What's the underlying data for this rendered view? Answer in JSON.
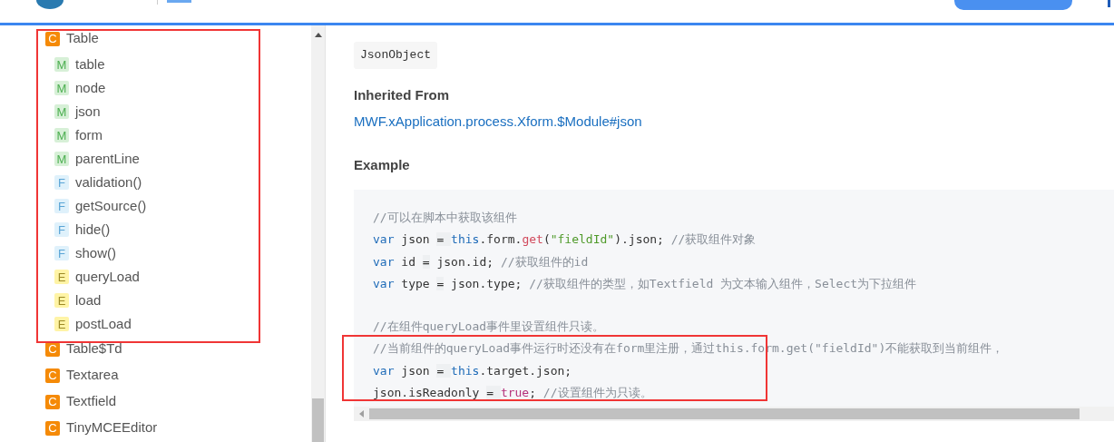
{
  "sidebar": {
    "items": [
      {
        "kind": "class",
        "badge": "C",
        "label": "Table",
        "children": [
          {
            "kind": "member",
            "badge": "M",
            "label": "table"
          },
          {
            "kind": "member",
            "badge": "M",
            "label": "node"
          },
          {
            "kind": "member",
            "badge": "M",
            "label": "json"
          },
          {
            "kind": "member",
            "badge": "M",
            "label": "form"
          },
          {
            "kind": "member",
            "badge": "M",
            "label": "parentLine"
          },
          {
            "kind": "function",
            "badge": "F",
            "label": "validation()"
          },
          {
            "kind": "function",
            "badge": "F",
            "label": "getSource()"
          },
          {
            "kind": "function",
            "badge": "F",
            "label": "hide()"
          },
          {
            "kind": "function",
            "badge": "F",
            "label": "show()"
          },
          {
            "kind": "event",
            "badge": "E",
            "label": "queryLoad"
          },
          {
            "kind": "event",
            "badge": "E",
            "label": "load"
          },
          {
            "kind": "event",
            "badge": "E",
            "label": "postLoad"
          }
        ]
      },
      {
        "kind": "class",
        "badge": "C",
        "label": "Table$Td"
      },
      {
        "kind": "class",
        "badge": "C",
        "label": "Textarea"
      },
      {
        "kind": "class",
        "badge": "C",
        "label": "Textfield"
      },
      {
        "kind": "class",
        "badge": "C",
        "label": "TinyMCEEditor"
      }
    ]
  },
  "content": {
    "type_code": "JsonObject",
    "inherited_heading": "Inherited From",
    "inherited_link": "MWF.xApplication.process.Xform.$Module#json",
    "example_heading": "Example",
    "code_blocks": [
      [
        [
          {
            "kind": "comment",
            "text": "//可以在脚本中获取该组件"
          }
        ],
        [
          {
            "kind": "keyword",
            "text": "var"
          },
          {
            "kind": "plain",
            "text": " json "
          },
          {
            "kind": "operator",
            "text": "= "
          },
          {
            "kind": "keyword",
            "text": "this"
          },
          {
            "kind": "plain",
            "text": ".form."
          },
          {
            "kind": "method",
            "text": "get"
          },
          {
            "kind": "plain",
            "text": "("
          },
          {
            "kind": "string",
            "text": "\"fieldId\""
          },
          {
            "kind": "plain",
            "text": ").json; "
          },
          {
            "kind": "comment",
            "text": "//获取组件对象"
          }
        ],
        [
          {
            "kind": "keyword",
            "text": "var"
          },
          {
            "kind": "plain",
            "text": " id "
          },
          {
            "kind": "operator",
            "text": "="
          },
          {
            "kind": "plain",
            "text": " json.id; "
          },
          {
            "kind": "comment",
            "text": "//获取组件的id"
          }
        ],
        [
          {
            "kind": "keyword",
            "text": "var"
          },
          {
            "kind": "plain",
            "text": " type "
          },
          {
            "kind": "operator",
            "text": "="
          },
          {
            "kind": "plain",
            "text": " json.type; "
          },
          {
            "kind": "comment",
            "text": "//获取组件的类型，如Textfield 为文本输入组件，Select为下拉组件"
          }
        ]
      ],
      [
        [
          {
            "kind": "comment",
            "text": "//在组件queryLoad事件里设置组件只读。"
          }
        ],
        [
          {
            "kind": "comment",
            "text": "//当前组件的queryLoad事件运行时还没有在form里注册，通过this.form.get(\"fieldId\")不能获取到当前组件，"
          }
        ],
        [
          {
            "kind": "keyword",
            "text": "var"
          },
          {
            "kind": "plain",
            "text": " json "
          },
          {
            "kind": "operator",
            "text": "= "
          },
          {
            "kind": "keyword",
            "text": "this"
          },
          {
            "kind": "plain",
            "text": ".target.json;"
          }
        ],
        [
          {
            "kind": "plain",
            "text": "json.isReadonly "
          },
          {
            "kind": "operator",
            "text": "= "
          },
          {
            "kind": "literal",
            "text": "true"
          },
          {
            "kind": "plain",
            "text": "; "
          },
          {
            "kind": "comment",
            "text": "//设置组件为只读。"
          }
        ]
      ]
    ]
  }
}
